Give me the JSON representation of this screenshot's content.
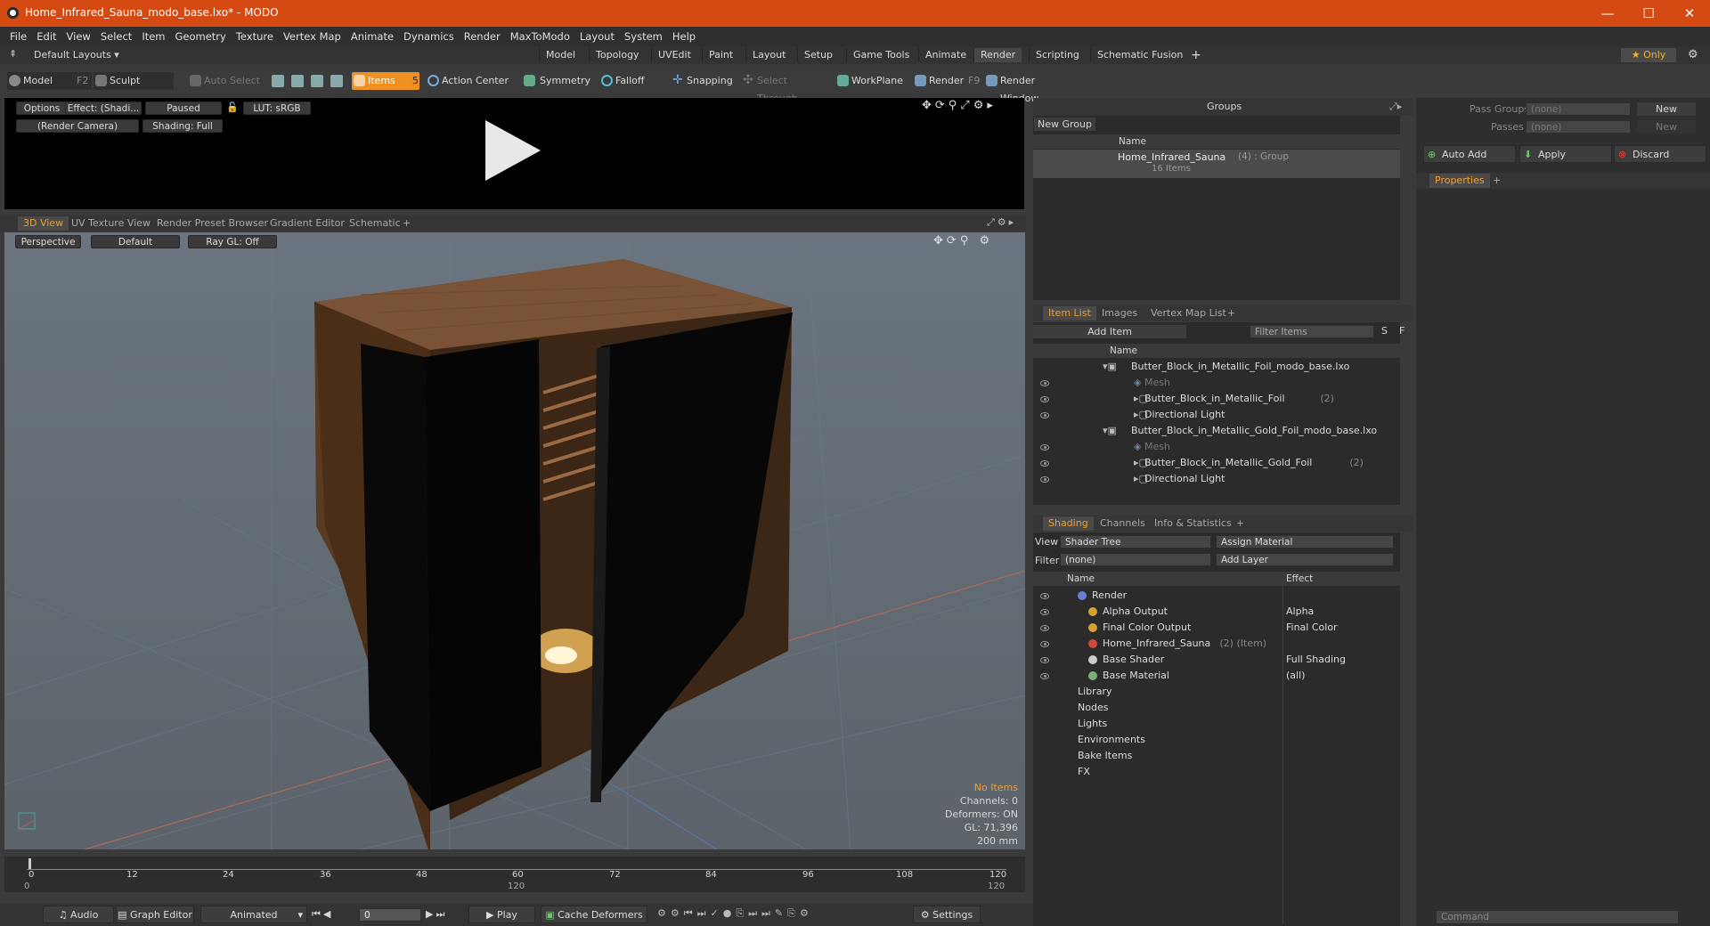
{
  "window": {
    "title": "Home_Infrared_Sauna_modo_base.lxo* - MODO",
    "min": "—",
    "max": "☐",
    "close": "✕"
  },
  "menu": [
    "File",
    "Edit",
    "View",
    "Select",
    "Item",
    "Geometry",
    "Texture",
    "Vertex Map",
    "Animate",
    "Dynamics",
    "Render",
    "MaxToModo",
    "Layout",
    "System",
    "Help"
  ],
  "topbar": {
    "layouts": "Default Layouts ▾",
    "tabs": [
      "Model",
      "Topology",
      "UVEdit",
      "Paint",
      "Layout",
      "Setup",
      "Game Tools",
      "Animate",
      "Render",
      "Scripting",
      "Schematic Fusion"
    ],
    "active": "Render",
    "plus": "+",
    "only": "★ Only"
  },
  "toolbar": {
    "model": "Model",
    "model_key": "F2",
    "sculpt": "Sculpt",
    "auto_select": "Auto Select",
    "items": "Items",
    "items_key": "5",
    "action_center": "Action Center",
    "symmetry": "Symmetry",
    "falloff": "Falloff",
    "snapping": "Snapping",
    "select_through": "Select Through",
    "workplane": "WorkPlane",
    "render": "Render",
    "render_key": "F9",
    "render_window": "Render Window"
  },
  "render_view": {
    "options": "Options",
    "effect": "Effect: (Shadi...",
    "paused": "Paused",
    "lut": "LUT: sRGB",
    "camera": "(Render Camera)",
    "shading": "Shading: Full"
  },
  "viewport": {
    "tabs": [
      "3D View",
      "UV Texture View",
      "Render Preset Browser",
      "Gradient Editor",
      "Schematic"
    ],
    "plus": "+",
    "perspective": "Perspective",
    "default": "Default",
    "raygl": "Ray GL: Off",
    "info": {
      "items": "No Items",
      "channels": "Channels: 0",
      "deformers": "Deformers: ON",
      "gl": "GL: 71,396",
      "size": "200 mm"
    }
  },
  "groups": {
    "title": "Groups",
    "new_group": "New Group",
    "col_name": "Name",
    "item": "Home_Infrared_Sauna",
    "item_suffix": "(4) : Group",
    "item_sub": "16 Items"
  },
  "item_list": {
    "tabs": [
      "Item List",
      "Images",
      "Vertex Map List"
    ],
    "plus": "+",
    "add_item": "Add Item",
    "filter": "Filter Items",
    "s": "S",
    "f": "F",
    "col_name": "Name",
    "rows": [
      {
        "label": "Butter_Block_in_Metallic_Foil_modo_base.lxo",
        "indent": 0,
        "dim": false,
        "count": ""
      },
      {
        "label": "Mesh",
        "indent": 2,
        "dim": true,
        "count": ""
      },
      {
        "label": "Butter_Block_in_Metallic_Foil",
        "indent": 1,
        "dim": false,
        "count": "(2)"
      },
      {
        "label": "Directional Light",
        "indent": 1,
        "dim": false,
        "count": ""
      },
      {
        "label": "Butter_Block_in_Metallic_Gold_Foil_modo_base.lxo",
        "indent": 0,
        "dim": false,
        "count": ""
      },
      {
        "label": "Mesh",
        "indent": 2,
        "dim": true,
        "count": ""
      },
      {
        "label": "Butter_Block_in_Metallic_Gold_Foil",
        "indent": 1,
        "dim": false,
        "count": "(2)"
      },
      {
        "label": "Directional Light",
        "indent": 1,
        "dim": false,
        "count": ""
      }
    ]
  },
  "shading": {
    "tabs": [
      "Shading",
      "Channels",
      "Info & Statistics"
    ],
    "plus": "+",
    "view_label": "View",
    "view_val": "Shader Tree",
    "assign": "Assign Material",
    "filter_label": "Filter",
    "filter_val": "(none)",
    "add_layer": "Add Layer",
    "col_name": "Name",
    "col_effect": "Effect",
    "rows": [
      {
        "name": "Render",
        "effect": "",
        "indent": 1
      },
      {
        "name": "Alpha Output",
        "effect": "Alpha",
        "indent": 2
      },
      {
        "name": "Final Color Output",
        "effect": "Final Color",
        "indent": 2
      },
      {
        "name": "Home_Infrared_Sauna",
        "effect": "",
        "indent": 2,
        "suffix": "(2) (Item)"
      },
      {
        "name": "Base Shader",
        "effect": "Full Shading",
        "indent": 2
      },
      {
        "name": "Base Material",
        "effect": "(all)",
        "indent": 2
      },
      {
        "name": "Library",
        "effect": "",
        "indent": 1
      },
      {
        "name": "Nodes",
        "effect": "",
        "indent": 1
      },
      {
        "name": "Lights",
        "effect": "",
        "indent": 0
      },
      {
        "name": "Environments",
        "effect": "",
        "indent": 0
      },
      {
        "name": "Bake Items",
        "effect": "",
        "indent": 0
      },
      {
        "name": "FX",
        "effect": "",
        "indent": 0
      }
    ]
  },
  "right": {
    "pass_groups": "Pass Groups",
    "passes": "Passes",
    "none": "(none)",
    "new": "New",
    "auto_add": "Auto Add",
    "apply": "Apply",
    "discard": "Discard",
    "properties": "Properties",
    "plus": "+",
    "command": "Command"
  },
  "timeline": {
    "ticks": [
      "0",
      "12",
      "24",
      "36",
      "48",
      "60",
      "72",
      "84",
      "96",
      "108",
      "120"
    ],
    "sub0": "0",
    "sub120": "120",
    "end120": "120"
  },
  "bottom": {
    "audio": "Audio",
    "graph": "Graph Editor",
    "animated": "Animated",
    "frame": "0",
    "play": "Play",
    "cache": "Cache Deformers",
    "settings": "Settings"
  }
}
